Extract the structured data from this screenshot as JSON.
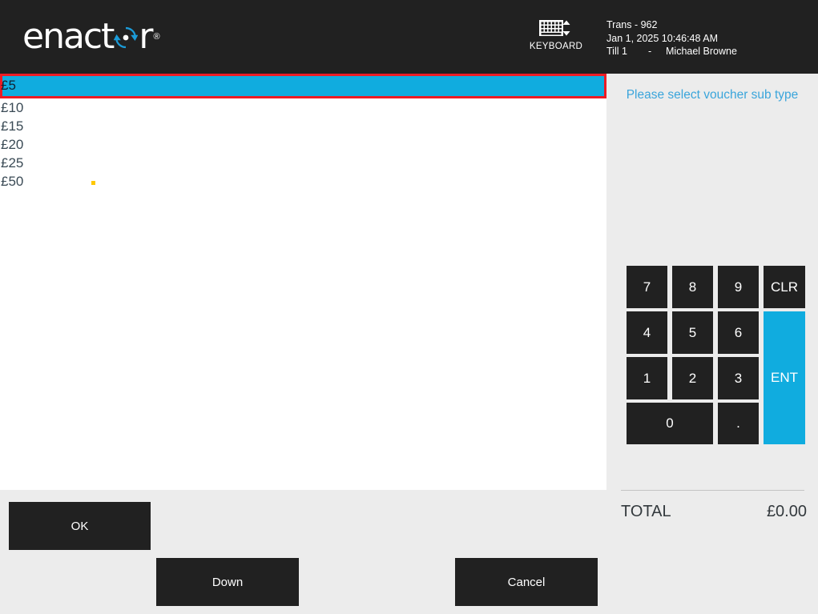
{
  "header": {
    "logo_text_before": "enact",
    "logo_icon": "cycle-arrows-icon",
    "logo_text_after": "r",
    "logo_trademark": "®",
    "keyboard_button": {
      "icon": "keyboard-icon",
      "label": "KEYBOARD"
    },
    "transaction": {
      "trans": "Trans - 962",
      "datetime": "Jan 1, 2025 10:46:48 AM",
      "till": "Till 1",
      "separator": "-",
      "operator": "Michael Browne"
    }
  },
  "list": {
    "items": [
      {
        "label": "£5",
        "selected": true
      },
      {
        "label": "£10",
        "selected": false
      },
      {
        "label": "£15",
        "selected": false
      },
      {
        "label": "£20",
        "selected": false
      },
      {
        "label": "£25",
        "selected": false
      },
      {
        "label": "£50",
        "selected": false
      }
    ]
  },
  "buttons": {
    "ok": "OK",
    "down": "Down",
    "cancel": "Cancel"
  },
  "right_panel": {
    "prompt": "Please select voucher sub type",
    "keypad": {
      "k7": "7",
      "k8": "8",
      "k9": "9",
      "kclr": "CLR",
      "k4": "4",
      "k5": "5",
      "k6": "6",
      "kent": "ENT",
      "k1": "1",
      "k2": "2",
      "k3": "3",
      "k0": "0",
      "kdot": "."
    },
    "total_label": "TOTAL",
    "total_value": "£0.00"
  },
  "colors": {
    "header_bg": "#212121",
    "accent_blue": "#10ACDF",
    "selection_outline": "#ED1C24",
    "panel_bg": "#ECECEC",
    "prompt_text": "#3AA5DB",
    "marker_yellow": "#FFC800"
  }
}
